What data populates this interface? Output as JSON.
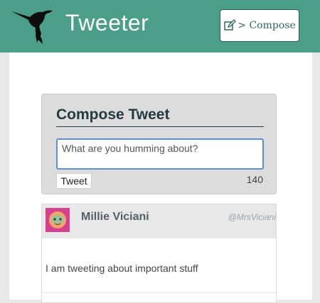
{
  "nav": {
    "brand": "Tweeter",
    "compose_label": "> Compose",
    "logo_icon": "hummingbird-icon",
    "compose_icon": "edit-icon",
    "bg_color": "#4b9e87"
  },
  "compose": {
    "title": "Compose Tweet",
    "placeholder": "What are you humming about?",
    "button_label": "Tweet",
    "counter": "140"
  },
  "tweet": {
    "author_name": "Millie Viciani",
    "author_handle": "@MrsViciani",
    "content": "I am tweeting about important stuff",
    "avatar_icon": "avatar-icon"
  }
}
